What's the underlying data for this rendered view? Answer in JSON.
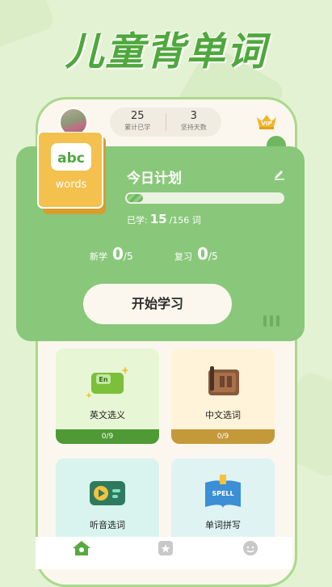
{
  "headline": "儿童背单词",
  "stats": [
    {
      "value": "25",
      "label": "累计已学"
    },
    {
      "value": "3",
      "label": "坚持天数"
    }
  ],
  "vip_label": "VIP",
  "book": {
    "logo": "abc",
    "label": "words"
  },
  "plan": {
    "title": "今日计划",
    "learned_prefix": "已学:",
    "learned_value": "15",
    "learned_total": "/156 词",
    "progress_fraction": 0.096,
    "new_label": "新学",
    "new_value": "0",
    "new_total": "/5",
    "review_label": "复习",
    "review_value": "0",
    "review_total": "/5",
    "start_button": "开始学习"
  },
  "cards": [
    {
      "name": "英文选义",
      "progress": "0/9",
      "bg": "#e7f6d5",
      "bar": "#4f9a35"
    },
    {
      "name": "中文选词",
      "progress": "0/9",
      "bg": "#fff3d9",
      "bar": "#c4993a"
    },
    {
      "name": "听音选词",
      "progress": "",
      "bg": "#d9f4ee",
      "bar": "#2f9a7c"
    },
    {
      "name": "单词拼写",
      "progress": "",
      "bg": "#dff3f3",
      "bar": "#2a8aa1"
    }
  ],
  "icons": {
    "en": "english-card-icon",
    "cn": "chinese-book-icon",
    "audio": "audio-player-icon",
    "spell": "spell-book-icon"
  },
  "colors": {
    "brand_green": "#4fa83c",
    "panel_green": "#89c87a",
    "cream": "#fbf7ee"
  }
}
